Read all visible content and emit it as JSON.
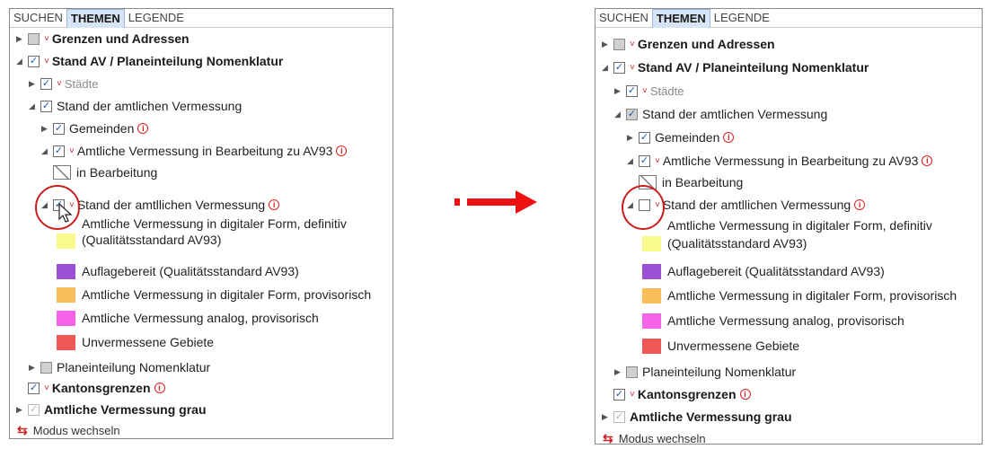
{
  "tabs": [
    "SUCHEN",
    "THEMEN",
    "LEGENDE"
  ],
  "tree": {
    "grenzen": "Grenzen und Adressen",
    "stand_av": "Stand AV / Planeinteilung Nomenklatur",
    "staedte": "Städte",
    "stand_amtlichen": "Stand der amtlichen Vermessung",
    "gemeinden": "Gemeinden",
    "amtliche_bearbeitung": "Amtliche Vermessung in Bearbeitung zu AV93",
    "in_bearbeitung": "in Bearbeitung",
    "stand_amtllichen": "Stand der amtllichen Vermessung",
    "planeinteilung": "Planeinteilung Nomenklatur",
    "kantonsgrenzen": "Kantonsgrenzen",
    "amtliche_grau": "Amtliche Vermessung grau"
  },
  "legend": [
    {
      "line1": "Amtliche Vermessung in digitaler Form, definitiv",
      "line2": "(Qualitätsstandard AV93)",
      "color": "#fafa8c"
    },
    {
      "line1": "Auflagebereit (Qualitätsstandard AV93)",
      "line2": "",
      "color": "#9b4fd6"
    },
    {
      "line1": "Amtliche Vermessung in digitaler Form, provisorisch",
      "line2": "",
      "color": "#f9bd5a"
    },
    {
      "line1": "Amtliche Vermessung analog, provisorisch",
      "line2": "",
      "color": "#f762e6"
    },
    {
      "line1": "Unvermessene Gebiete",
      "line2": "",
      "color": "#f05858"
    }
  ],
  "footer": {
    "label": "Modus wechseln"
  },
  "state": {
    "before_target_checked": true,
    "after_target_checked": false
  },
  "colors": {
    "accent": "#e02020",
    "tab_active_bg": "#d6e4f5",
    "check": "#1d5bb5"
  },
  "icons": {
    "info": "info-icon",
    "hatch": "hatch-swatch-icon",
    "mode": "mode-switch-icon",
    "arrow": "right-arrow"
  }
}
